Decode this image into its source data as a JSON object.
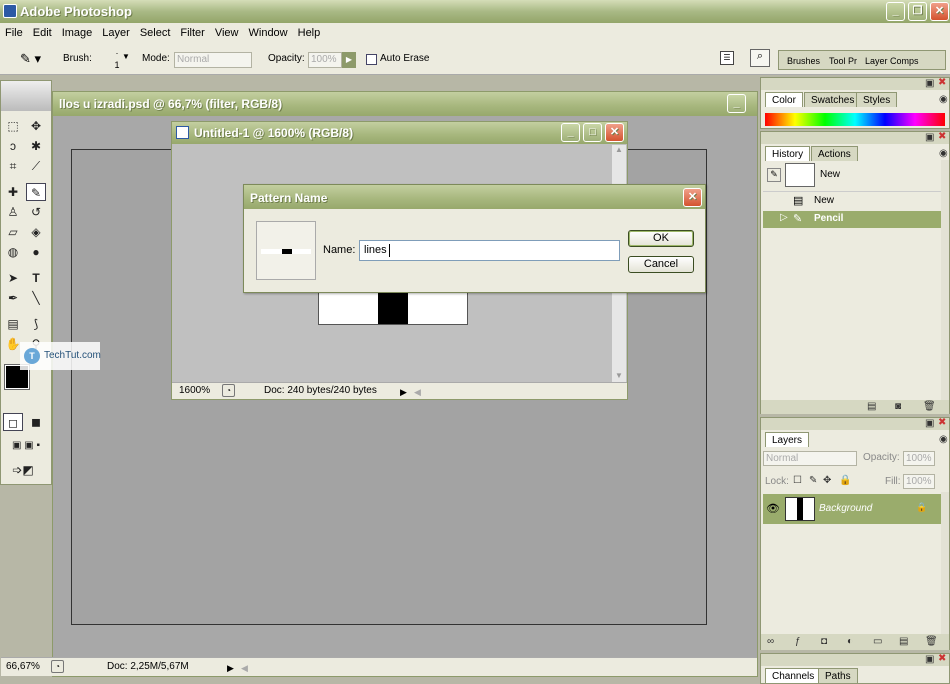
{
  "app": {
    "title": "Adobe Photoshop"
  },
  "menu": [
    "File",
    "Edit",
    "Image",
    "Layer",
    "Select",
    "Filter",
    "View",
    "Window",
    "Help"
  ],
  "options": {
    "brush_label": "Brush:",
    "brush_size": "1",
    "mode_label": "Mode:",
    "mode_value": "Normal",
    "opacity_label": "Opacity:",
    "opacity_value": "100%",
    "auto_erase_label": "Auto Erase",
    "well_tabs": [
      "Brushes",
      "Tool Pr",
      "Layer Comps"
    ]
  },
  "back_doc": {
    "title": "llos u izradi.psd @ 66,7% (filter, RGB/8)",
    "zoom": "66,67%",
    "doc_info": "Doc: 2,25M/5,67M"
  },
  "front_doc": {
    "title": "Untitled-1 @ 1600% (RGB/8)",
    "zoom": "1600%",
    "doc_info": "Doc: 240 bytes/240 bytes"
  },
  "dialog": {
    "title": "Pattern Name",
    "name_label": "Name:",
    "name_value": "lines",
    "ok_label": "OK",
    "cancel_label": "Cancel"
  },
  "watermark": "TechTut.com",
  "color_panel": {
    "tabs": [
      "Color",
      "Swatches",
      "Styles"
    ]
  },
  "history_panel": {
    "tabs": [
      "History",
      "Actions"
    ],
    "snapshot_label": "New",
    "items": [
      "New",
      "Pencil"
    ]
  },
  "layers_panel": {
    "tab": "Layers",
    "blend_mode": "Normal",
    "opacity_label": "Opacity:",
    "opacity_value": "100%",
    "lock_label": "Lock:",
    "fill_label": "Fill:",
    "fill_value": "100%",
    "layer_name": "Background"
  },
  "channels_panel": {
    "tabs": [
      "Channels",
      "Paths"
    ]
  }
}
